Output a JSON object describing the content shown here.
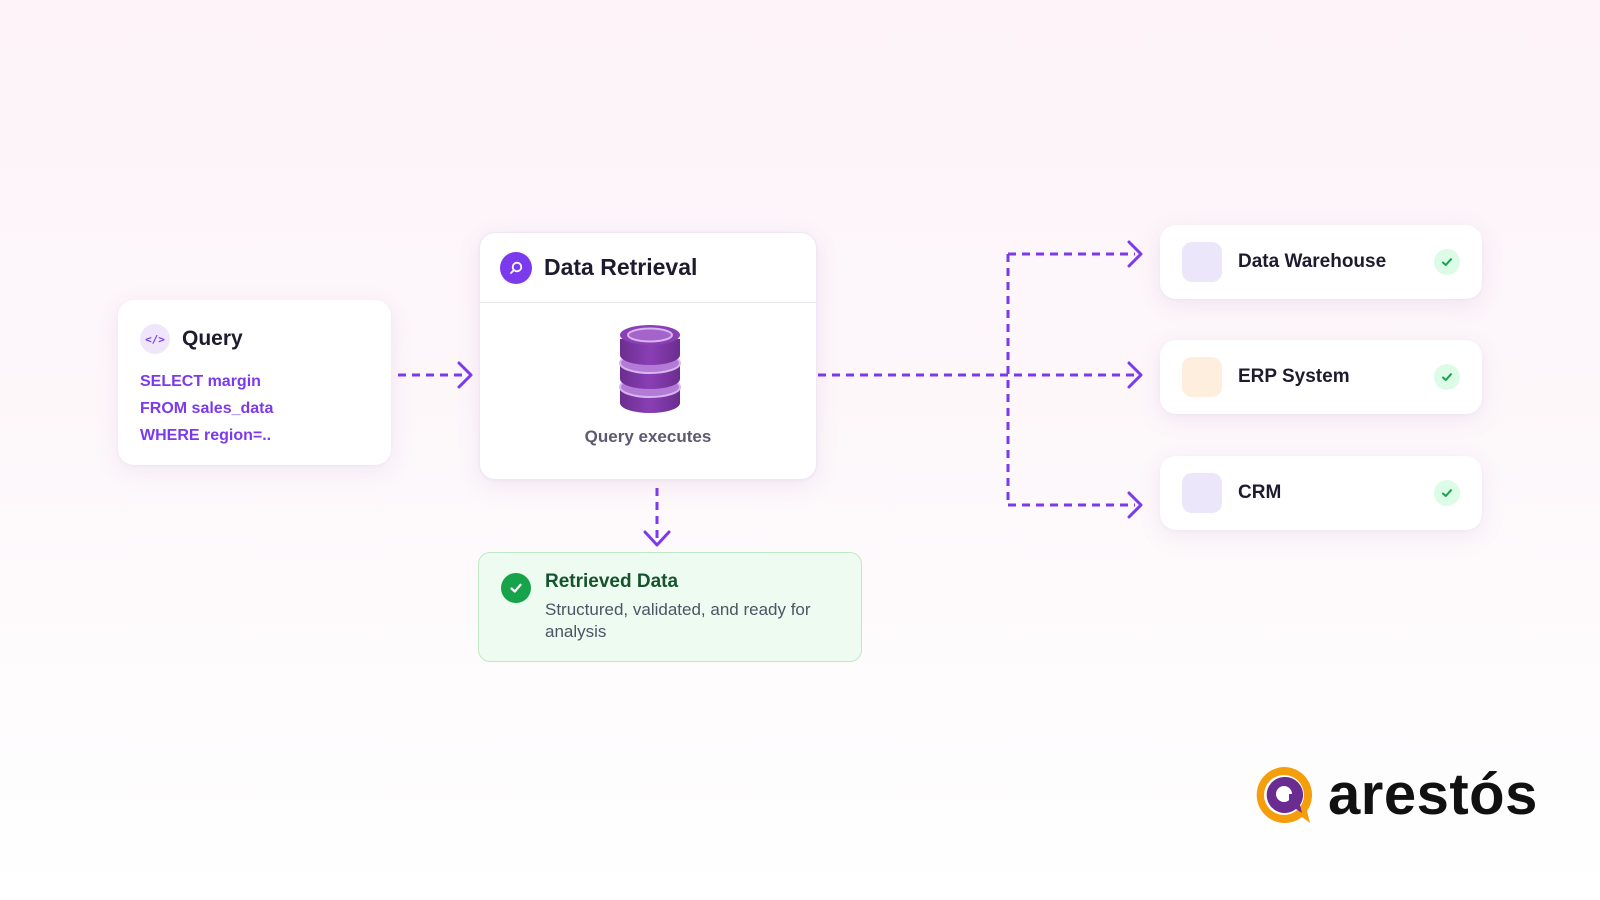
{
  "query": {
    "icon": "code-icon",
    "icon_glyph": "</>",
    "title": "Query",
    "sql_lines": [
      "SELECT margin",
      "FROM sales_data",
      "WHERE region=.."
    ]
  },
  "retrieval": {
    "icon": "search-icon",
    "title": "Data Retrieval",
    "db_icon": "database-icon",
    "caption": "Query executes"
  },
  "retrieved": {
    "icon": "check-icon",
    "title": "Retrieved Data",
    "description": "Structured, validated, and ready for analysis"
  },
  "sources": [
    {
      "label": "Data Warehouse",
      "swatch_color": "#ece6fb",
      "status_icon": "check-icon"
    },
    {
      "label": "ERP System",
      "swatch_color": "#fdeedd",
      "status_icon": "check-icon"
    },
    {
      "label": "CRM",
      "swatch_color": "#ece6fb",
      "status_icon": "check-icon"
    }
  ],
  "brand": {
    "wordmark": "arestós",
    "accent_purple": "#7c3aed",
    "logo_orange": "#f59e0b",
    "logo_purple": "#6b2c91",
    "success_green": "#16a34a"
  }
}
